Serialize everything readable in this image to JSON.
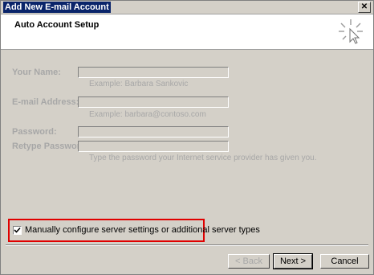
{
  "window": {
    "title": "Add New E-mail Account",
    "close_label": "✕"
  },
  "header": {
    "title": "Auto Account Setup"
  },
  "form": {
    "name_label": "Your Name:",
    "name_hint": "Example: Barbara Sankovic",
    "email_label": "E-mail Address:",
    "email_hint": "Example: barbara@contoso.com",
    "password_label": "Password:",
    "retype_label": "Retype Password:",
    "password_hint": "Type the password your Internet service provider has given you."
  },
  "manual_config": {
    "label": "Manually configure server settings or additional server types",
    "checked": true
  },
  "buttons": {
    "back": "< Back",
    "next": "Next >",
    "cancel": "Cancel"
  },
  "colors": {
    "highlight": "#e00000",
    "disabled_text": "#a7a7a7"
  }
}
